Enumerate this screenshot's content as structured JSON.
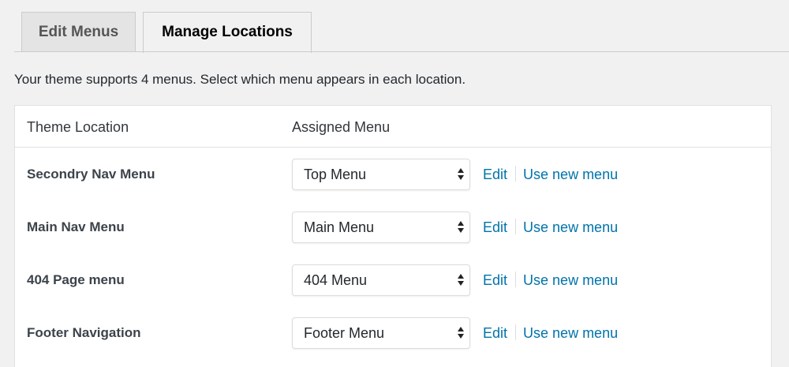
{
  "tabs": [
    {
      "label": "Edit Menus",
      "active": false
    },
    {
      "label": "Manage Locations",
      "active": true
    }
  ],
  "intro_text": "Your theme supports 4 menus. Select which menu appears in each location.",
  "table": {
    "headers": {
      "location": "Theme Location",
      "menu": "Assigned Menu"
    },
    "rows": [
      {
        "location": "Secondry Nav Menu",
        "menu": "Top Menu",
        "edit": "Edit",
        "use_new": "Use new menu"
      },
      {
        "location": "Main Nav Menu",
        "menu": "Main Menu",
        "edit": "Edit",
        "use_new": "Use new menu"
      },
      {
        "location": "404 Page menu",
        "menu": "404 Menu",
        "edit": "Edit",
        "use_new": "Use new menu"
      },
      {
        "location": "Footer Navigation",
        "menu": "Footer Menu",
        "edit": "Edit",
        "use_new": "Use new menu"
      }
    ]
  },
  "colors": {
    "link": "#0073aa",
    "background": "#f1f1f1",
    "panel": "#ffffff"
  },
  "icons": {
    "select_arrow": "up-down-caret-icon"
  }
}
